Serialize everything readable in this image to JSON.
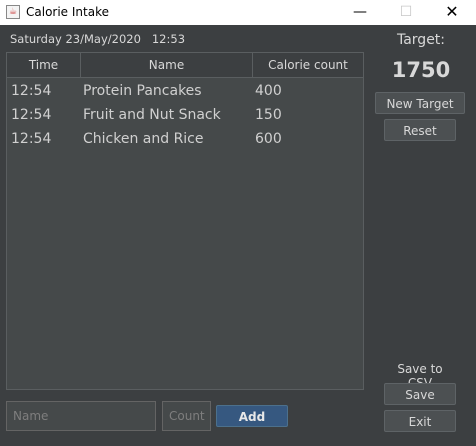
{
  "window": {
    "title": "Calorie Intake",
    "minimize_glyph": "—",
    "maximize_glyph": "☐",
    "close_glyph": "✕"
  },
  "header": {
    "datetime": "Saturday 23/May/2020   12:53"
  },
  "table": {
    "columns": [
      "Time",
      "Name",
      "Calorie count"
    ],
    "rows": [
      {
        "time": "12:54",
        "name": "Protein Pancakes",
        "calories": "400"
      },
      {
        "time": "12:54",
        "name": "Fruit and Nut Snack",
        "calories": "150"
      },
      {
        "time": "12:54",
        "name": "Chicken and Rice",
        "calories": "600"
      }
    ]
  },
  "target": {
    "label": "Target:",
    "value": "1750",
    "new_target_label": "New Target",
    "reset_label": "Reset"
  },
  "csv": {
    "label": "Save to CSV",
    "save_label": "Save",
    "exit_label": "Exit"
  },
  "entry": {
    "name_placeholder": "Name",
    "count_placeholder": "Count",
    "add_label": "Add"
  },
  "colors": {
    "background": "#3c3f41",
    "table_background": "#45494a",
    "add_button": "#365880"
  }
}
